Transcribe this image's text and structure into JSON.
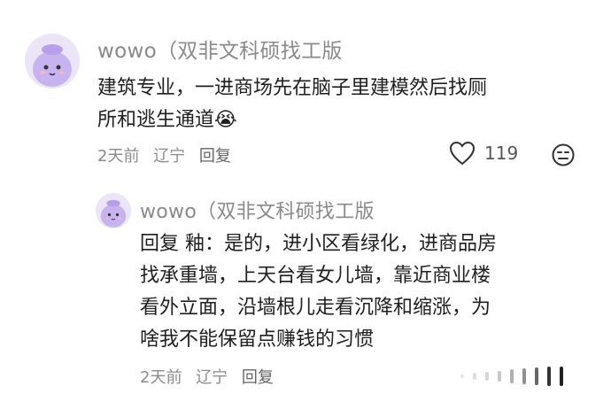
{
  "comment": {
    "username": "wowo（双非文科硕找工版",
    "text_line1": "建筑专业，一进商场先在脑子里建模然后找厕",
    "text_line2": "所和逃生通道",
    "emoji": "😭",
    "time": "2天前",
    "location": "辽宁",
    "reply_label": "回复",
    "like_count": "119"
  },
  "reply": {
    "username": "wowo（双非文科硕找工版",
    "prefix": "回复",
    "mention": "釉",
    "lines": [
      "回复  釉：是的，进小区看绿化，进商品房",
      "找承重墙，上天台看女儿墙，靠近商业楼",
      "看外立面，沿墙根儿走看沉降和缩涨，为",
      "啥我不能保留点赚钱的习惯"
    ],
    "time": "2天前",
    "location": "辽宁",
    "reply_label": "回复"
  },
  "icons": {
    "like": "heart-outline-icon",
    "emoji": "neutral-face-icon",
    "collapse": "vertical-bars-icon"
  },
  "colors": {
    "meta": "#8c8c8c",
    "avatar_bg": "#e9e2f7"
  }
}
